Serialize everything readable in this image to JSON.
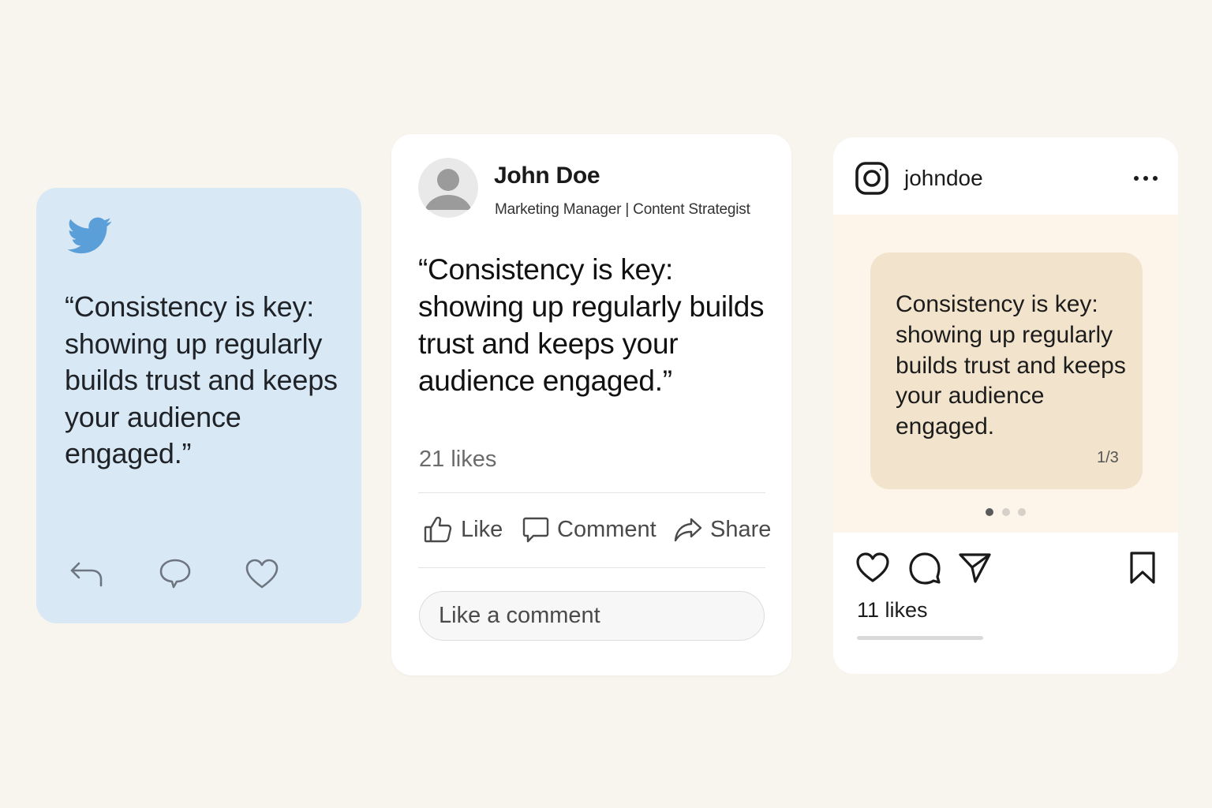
{
  "twitter": {
    "quote": "“Consistency is key: showing up regularly builds trust and keeps your audience engaged.”",
    "icons": [
      "twitter-bird-icon",
      "reply-icon",
      "comment-icon",
      "heart-icon"
    ],
    "colors": {
      "card_bg": "#d9e8f5",
      "brand": "#5a9fd8",
      "icon": "#6d7680"
    }
  },
  "linkedin": {
    "name": "John Doe",
    "subtitle": "Marketing Manager | Content Strategist",
    "quote": "“Consistency is key: showing up regularly builds trust and keeps your audience engaged.”",
    "likes": "21 likes",
    "actions": {
      "like": "Like",
      "comment": "Comment",
      "share": "Share"
    },
    "comment_placeholder": "Like a comment",
    "icons": [
      "avatar-icon",
      "thumbs-up-icon",
      "comment-icon",
      "share-icon"
    ]
  },
  "instagram": {
    "username": "johndoe",
    "slide_text": "Consistency is key: showing up regularly builds trust and keeps your audience engaged.",
    "slide_counter": "1/3",
    "carousel": {
      "total": 3,
      "active_index": 0
    },
    "likes": "11 likes",
    "icons": [
      "instagram-logo-icon",
      "more-options-icon",
      "heart-icon",
      "comment-icon",
      "send-icon",
      "bookmark-icon"
    ],
    "colors": {
      "slide_bg": "#f2e4cc",
      "media_bg": "#fdf5ea"
    }
  },
  "colors": {
    "page_bg": "#f8f4ee",
    "card_bg": "#ffffff"
  }
}
